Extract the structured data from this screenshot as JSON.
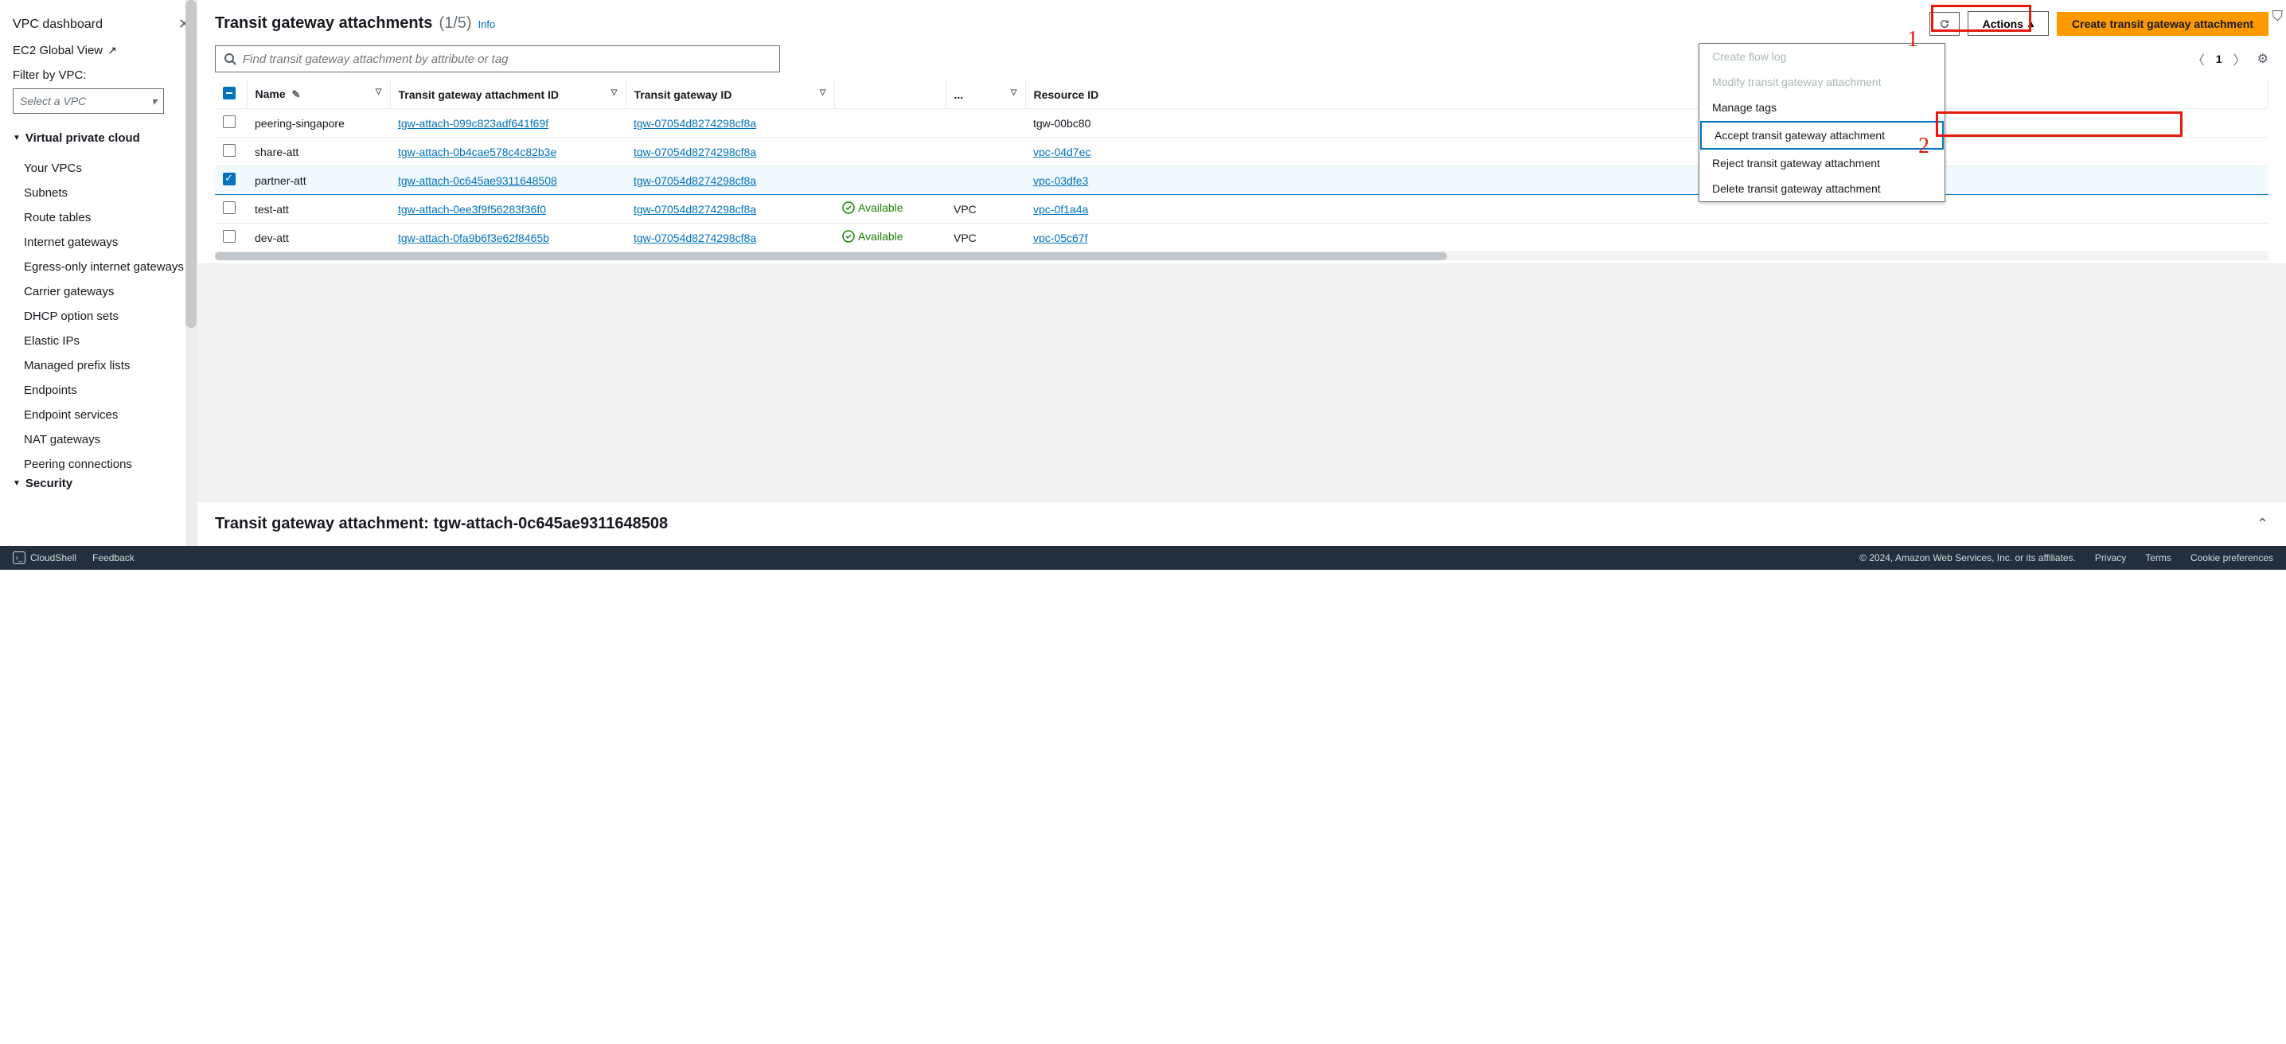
{
  "sidebar": {
    "title": "VPC dashboard",
    "ec2_link": "EC2 Global View",
    "filter_label": "Filter by VPC:",
    "filter_placeholder": "Select a VPC",
    "section1": "Virtual private cloud",
    "items1": [
      "Your VPCs",
      "Subnets",
      "Route tables",
      "Internet gateways",
      "Egress-only internet gateways",
      "Carrier gateways",
      "DHCP option sets",
      "Elastic IPs",
      "Managed prefix lists",
      "Endpoints",
      "Endpoint services",
      "NAT gateways",
      "Peering connections"
    ],
    "section2": "Security"
  },
  "header": {
    "title": "Transit gateway attachments",
    "count": "(1/5)",
    "info": "Info",
    "actions_btn": "Actions",
    "create_btn": "Create transit gateway attachment"
  },
  "search": {
    "placeholder": "Find transit gateway attachment by attribute or tag"
  },
  "pager": {
    "page": "1"
  },
  "dropdown": {
    "items": [
      {
        "label": "Create flow log",
        "disabled": true
      },
      {
        "label": "Modify transit gateway attachment",
        "disabled": true
      },
      {
        "label": "Manage tags",
        "disabled": false
      },
      {
        "label": "Accept transit gateway attachment",
        "disabled": false,
        "highlighted": true
      },
      {
        "label": "Reject transit gateway attachment",
        "disabled": false
      },
      {
        "label": "Delete transit gateway attachment",
        "disabled": false
      }
    ]
  },
  "columns": {
    "name": "Name",
    "attach_id": "Transit gateway attachment ID",
    "tgw_id": "Transit gateway ID",
    "dots": "...",
    "resource": "Resource ID"
  },
  "rows": [
    {
      "name": "peering-singapore",
      "attach": "tgw-attach-099c823adf641f69f",
      "tgw": "tgw-07054d8274298cf8a",
      "state": "",
      "type": "",
      "res": "tgw-00bc80",
      "selected": false
    },
    {
      "name": "share-att",
      "attach": "tgw-attach-0b4cae578c4c82b3e",
      "tgw": "tgw-07054d8274298cf8a",
      "state": "",
      "type": "",
      "res": "vpc-04d7ec",
      "selected": false,
      "res_link": true
    },
    {
      "name": "partner-att",
      "attach": "tgw-attach-0c645ae9311648508",
      "tgw": "tgw-07054d8274298cf8a",
      "state": "",
      "type": "",
      "res": "vpc-03dfe3",
      "selected": true,
      "res_link": true
    },
    {
      "name": "test-att",
      "attach": "tgw-attach-0ee3f9f56283f36f0",
      "tgw": "tgw-07054d8274298cf8a",
      "state": "Available",
      "type": "VPC",
      "res": "vpc-0f1a4a",
      "selected": false,
      "res_link": true
    },
    {
      "name": "dev-att",
      "attach": "tgw-attach-0fa9b6f3e62f8465b",
      "tgw": "tgw-07054d8274298cf8a",
      "state": "Available",
      "type": "VPC",
      "res": "vpc-05c67f",
      "selected": false,
      "res_link": true
    }
  ],
  "detail": {
    "title": "Transit gateway attachment: tgw-attach-0c645ae9311648508"
  },
  "annotations": {
    "num1": "1",
    "num2": "2"
  },
  "footer": {
    "cloudshell": "CloudShell",
    "feedback": "Feedback",
    "copyright": "© 2024, Amazon Web Services, Inc. or its affiliates.",
    "privacy": "Privacy",
    "terms": "Terms",
    "cookie": "Cookie preferences"
  }
}
